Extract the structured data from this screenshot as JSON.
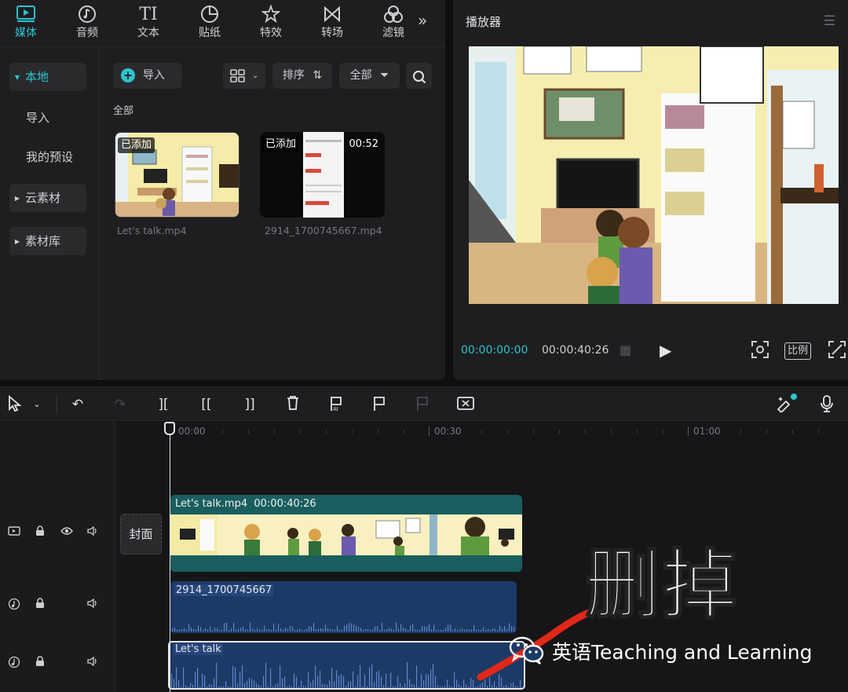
{
  "top_tabs": [
    {
      "label": "媒体",
      "icon": "media-icon",
      "active": true
    },
    {
      "label": "音频",
      "icon": "audio-icon"
    },
    {
      "label": "文本",
      "icon": "text-icon",
      "glyph": "TI"
    },
    {
      "label": "贴纸",
      "icon": "sticker-icon"
    },
    {
      "label": "特效",
      "icon": "effects-icon"
    },
    {
      "label": "转场",
      "icon": "transition-icon"
    },
    {
      "label": "滤镜",
      "icon": "filter-icon"
    }
  ],
  "side_nav": {
    "local": "本地",
    "import": "导入",
    "my_presets": "我的预设",
    "cloud": "云素材",
    "library": "素材库"
  },
  "media_toolbar": {
    "import": "导入",
    "sort": "排序",
    "filter": "全部"
  },
  "media_section": "全部",
  "media_items": [
    {
      "badge": "已添加",
      "name": "Let's talk.mp4"
    },
    {
      "badge": "已添加",
      "duration": "00:52",
      "name": "2914_1700745667.mp4"
    }
  ],
  "player": {
    "title": "播放器",
    "time_current": "00:00:00:00",
    "time_total": "00:00:40:26",
    "ratio_label": "比例"
  },
  "ruler": {
    "ticks": [
      "00:00",
      "00:30",
      "01:00"
    ]
  },
  "timeline": {
    "cover_label": "封面",
    "video_clip_name": "Let's talk.mp4",
    "video_clip_duration": "00:00:40:26",
    "audio_clip1_name": "2914_1700745667",
    "audio_clip2_name": "Let's talk"
  },
  "annotation": {
    "text": "删掉",
    "watermark": "英语Teaching and Learning"
  },
  "colors": {
    "accent": "#2bc4cf",
    "video_track": "#1a5e5f",
    "audio_track": "#1c3a66",
    "annotation_red": "#e0271a"
  }
}
